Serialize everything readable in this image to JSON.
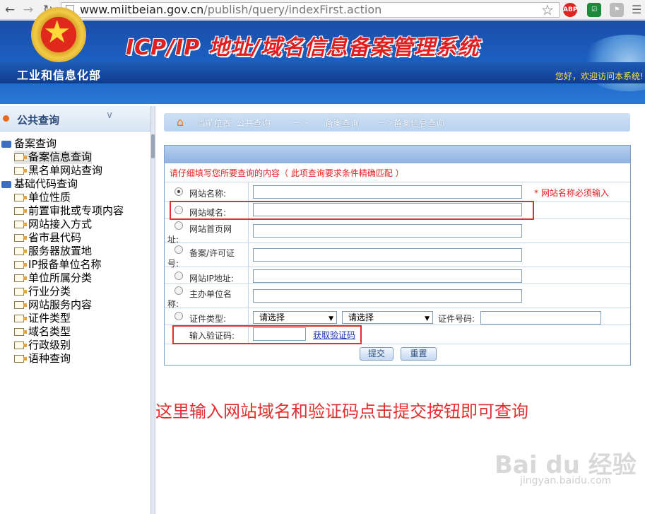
{
  "browser": {
    "back_icon": "back-arrow-icon",
    "forward_icon": "forward-arrow-icon",
    "reload_icon": "reload-icon",
    "url_host": "www.miitbeian.gov.cn",
    "url_path": "/publish/query/indexFirst.action",
    "ext_abp": "ABP",
    "ext_shield": "shield-icon"
  },
  "banner": {
    "ministry": "工业和信息化部",
    "title": "ICP/IP 地址/域名信息备案管理系统",
    "welcome": "您好，欢迎访问本系统!"
  },
  "sidebar": {
    "header": "公共查询",
    "groups": [
      {
        "label": "备案查询",
        "items": [
          "备案信息查询",
          "黑名单网站查询"
        ]
      },
      {
        "label": "基础代码查询",
        "items": [
          "单位性质",
          "前置审批或专项内容",
          "网站接入方式",
          "省市县代码",
          "服务器放置地",
          "IP报备单位名称",
          "单位所属分类",
          "行业分类",
          "网站服务内容",
          "证件类型",
          "域名类型",
          "行政级别",
          "语种查询"
        ]
      }
    ]
  },
  "breadcrumb": {
    "label": "当前位置: 公共查询",
    "sep1": "－＞",
    "mid": "备案查询",
    "last": "－＞备案信息查询"
  },
  "form": {
    "instruction": "请仔细填写您所要查询的内容（ 此项查询要求条件精确匹配 ）",
    "fields": [
      {
        "label": "网站名称:"
      },
      {
        "label": "网站域名:"
      },
      {
        "label": "网站首页网",
        "label2": "址:"
      },
      {
        "label": "备案/许可证",
        "label2": "号:"
      },
      {
        "label": "网站IP地址:"
      },
      {
        "label": "主办单位名",
        "label2": "称:"
      }
    ],
    "required_note": "* 网站名称必须输入",
    "cert_type_label": "证件类型:",
    "select1": "请选择",
    "select2": "请选择",
    "cert_no_label": "证件号码:",
    "captcha_label": "输入验证码:",
    "captcha_link": "获取验证码",
    "submit": "提交",
    "reset": "重置"
  },
  "annotation": "这里输入网站域名和验证码点击提交按钮即可查询",
  "watermark": {
    "main": "Bai du 经验",
    "sub": "jingyan.baidu.com"
  }
}
